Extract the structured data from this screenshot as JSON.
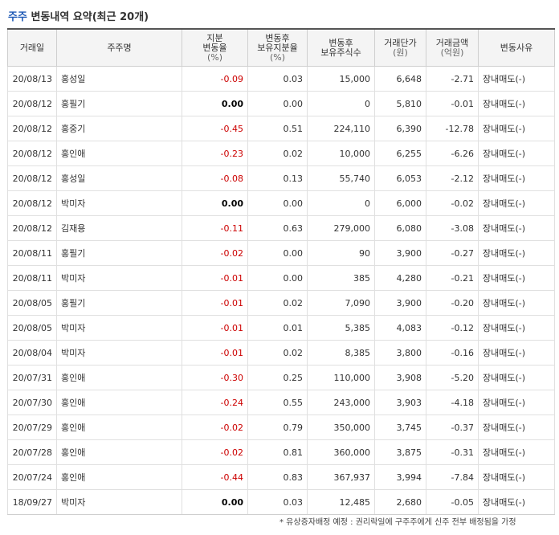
{
  "title": {
    "prefix": "주주",
    "main": "변동내역 요약(최근 20개)"
  },
  "colors": {
    "title_accent": "#1f5ab6",
    "negative": "#cc0000",
    "header_bg": "#f4f4f4"
  },
  "headers": [
    {
      "line1": "거래일",
      "line2": "",
      "unit": ""
    },
    {
      "line1": "주주명",
      "line2": "",
      "unit": ""
    },
    {
      "line1": "지분",
      "line2": "변동율",
      "unit": "(%)"
    },
    {
      "line1": "변동후",
      "line2": "보유지분율",
      "unit": "(%)"
    },
    {
      "line1": "변동후",
      "line2": "보유주식수",
      "unit": ""
    },
    {
      "line1": "거래단가",
      "line2": "",
      "unit": "(원)"
    },
    {
      "line1": "거래금액",
      "line2": "",
      "unit": "(억원)"
    },
    {
      "line1": "변동사유",
      "line2": "",
      "unit": ""
    }
  ],
  "rows": [
    {
      "date": "20/08/13",
      "name": "홍성일",
      "rate": "-0.09",
      "holding_pct": "0.03",
      "shares": "15,000",
      "price": "6,648",
      "amount": "-2.71",
      "reason": "장내매도(-)"
    },
    {
      "date": "20/08/12",
      "name": "홍필기",
      "rate": "0.00",
      "holding_pct": "0.00",
      "shares": "0",
      "price": "5,810",
      "amount": "-0.01",
      "reason": "장내매도(-)"
    },
    {
      "date": "20/08/12",
      "name": "홍중기",
      "rate": "-0.45",
      "holding_pct": "0.51",
      "shares": "224,110",
      "price": "6,390",
      "amount": "-12.78",
      "reason": "장내매도(-)"
    },
    {
      "date": "20/08/12",
      "name": "홍인애",
      "rate": "-0.23",
      "holding_pct": "0.02",
      "shares": "10,000",
      "price": "6,255",
      "amount": "-6.26",
      "reason": "장내매도(-)"
    },
    {
      "date": "20/08/12",
      "name": "홍성일",
      "rate": "-0.08",
      "holding_pct": "0.13",
      "shares": "55,740",
      "price": "6,053",
      "amount": "-2.12",
      "reason": "장내매도(-)"
    },
    {
      "date": "20/08/12",
      "name": "박미자",
      "rate": "0.00",
      "holding_pct": "0.00",
      "shares": "0",
      "price": "6,000",
      "amount": "-0.02",
      "reason": "장내매도(-)"
    },
    {
      "date": "20/08/12",
      "name": "김재용",
      "rate": "-0.11",
      "holding_pct": "0.63",
      "shares": "279,000",
      "price": "6,080",
      "amount": "-3.08",
      "reason": "장내매도(-)"
    },
    {
      "date": "20/08/11",
      "name": "홍필기",
      "rate": "-0.02",
      "holding_pct": "0.00",
      "shares": "90",
      "price": "3,900",
      "amount": "-0.27",
      "reason": "장내매도(-)"
    },
    {
      "date": "20/08/11",
      "name": "박미자",
      "rate": "-0.01",
      "holding_pct": "0.00",
      "shares": "385",
      "price": "4,280",
      "amount": "-0.21",
      "reason": "장내매도(-)"
    },
    {
      "date": "20/08/05",
      "name": "홍필기",
      "rate": "-0.01",
      "holding_pct": "0.02",
      "shares": "7,090",
      "price": "3,900",
      "amount": "-0.20",
      "reason": "장내매도(-)"
    },
    {
      "date": "20/08/05",
      "name": "박미자",
      "rate": "-0.01",
      "holding_pct": "0.01",
      "shares": "5,385",
      "price": "4,083",
      "amount": "-0.12",
      "reason": "장내매도(-)"
    },
    {
      "date": "20/08/04",
      "name": "박미자",
      "rate": "-0.01",
      "holding_pct": "0.02",
      "shares": "8,385",
      "price": "3,800",
      "amount": "-0.16",
      "reason": "장내매도(-)"
    },
    {
      "date": "20/07/31",
      "name": "홍인애",
      "rate": "-0.30",
      "holding_pct": "0.25",
      "shares": "110,000",
      "price": "3,908",
      "amount": "-5.20",
      "reason": "장내매도(-)"
    },
    {
      "date": "20/07/30",
      "name": "홍인애",
      "rate": "-0.24",
      "holding_pct": "0.55",
      "shares": "243,000",
      "price": "3,903",
      "amount": "-4.18",
      "reason": "장내매도(-)"
    },
    {
      "date": "20/07/29",
      "name": "홍인애",
      "rate": "-0.02",
      "holding_pct": "0.79",
      "shares": "350,000",
      "price": "3,745",
      "amount": "-0.37",
      "reason": "장내매도(-)"
    },
    {
      "date": "20/07/28",
      "name": "홍인애",
      "rate": "-0.02",
      "holding_pct": "0.81",
      "shares": "360,000",
      "price": "3,875",
      "amount": "-0.31",
      "reason": "장내매도(-)"
    },
    {
      "date": "20/07/24",
      "name": "홍인애",
      "rate": "-0.44",
      "holding_pct": "0.83",
      "shares": "367,937",
      "price": "3,994",
      "amount": "-7.84",
      "reason": "장내매도(-)"
    },
    {
      "date": "18/09/27",
      "name": "박미자",
      "rate": "0.00",
      "holding_pct": "0.03",
      "shares": "12,485",
      "price": "2,680",
      "amount": "-0.05",
      "reason": "장내매도(-)"
    }
  ],
  "footnote": "* 유상증자배정 예정 : 권리락일에 구주주에게 신주 전부 배정됨을 가정"
}
